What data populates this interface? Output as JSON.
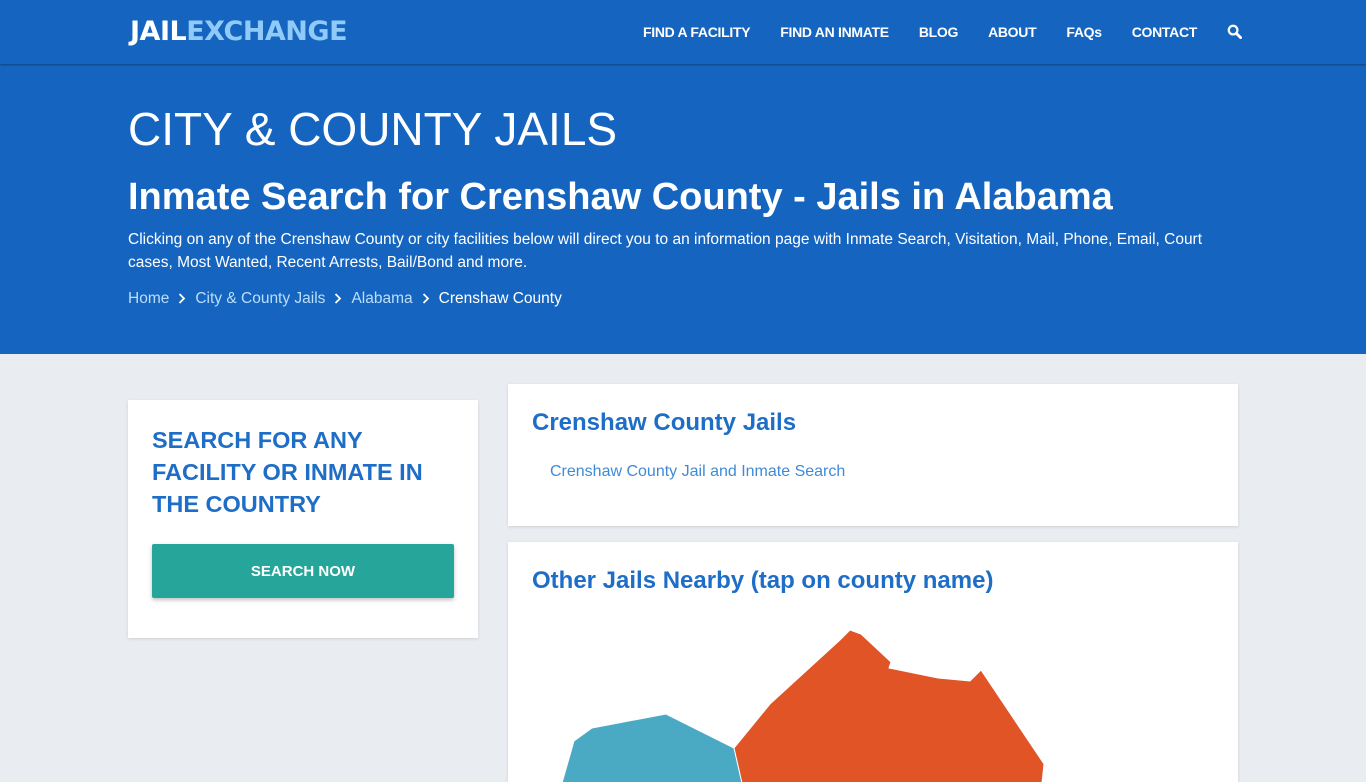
{
  "header": {
    "logo": {
      "part1": "JAIL",
      "part2": "EXCHANGE"
    },
    "nav": [
      {
        "label": "FIND A FACILITY"
      },
      {
        "label": "FIND AN INMATE"
      },
      {
        "label": "BLOG"
      },
      {
        "label": "ABOUT"
      },
      {
        "label": "FAQs"
      },
      {
        "label": "CONTACT"
      }
    ],
    "search_icon": "search-icon"
  },
  "hero": {
    "section_title": "CITY & COUNTY JAILS",
    "page_title": "Inmate Search for Crenshaw County - Jails in Alabama",
    "description": "Clicking on any of the Crenshaw County or city facilities below will direct you to an information page with Inmate Search, Visitation, Mail, Phone, Email, Court cases, Most Wanted, Recent Arrests, Bail/Bond and more.",
    "breadcrumb": [
      {
        "label": "Home"
      },
      {
        "label": "City & County Jails"
      },
      {
        "label": "Alabama"
      },
      {
        "label": "Crenshaw County"
      }
    ],
    "breadcrumb_separator_icon": "chevron-right-icon"
  },
  "sidebar": {
    "heading": "SEARCH FOR ANY FACILITY OR INMATE IN THE COUNTRY",
    "button_label": "SEARCH NOW"
  },
  "jails_card": {
    "title": "Crenshaw County Jails",
    "links": [
      {
        "label": "Crenshaw County Jail and Inmate Search"
      }
    ]
  },
  "nearby_card": {
    "title": "Other Jails Nearby (tap on county name)",
    "map_regions": [
      {
        "name": "county-west",
        "color": "#4aaac4"
      },
      {
        "name": "county-center",
        "color": "#e05426"
      }
    ]
  },
  "colors": {
    "brand_blue": "#1565c0",
    "logo_accent": "#90caf9",
    "heading_blue": "#1e6ec7",
    "button_teal": "#26a69a",
    "page_bg": "#e9edf1"
  }
}
